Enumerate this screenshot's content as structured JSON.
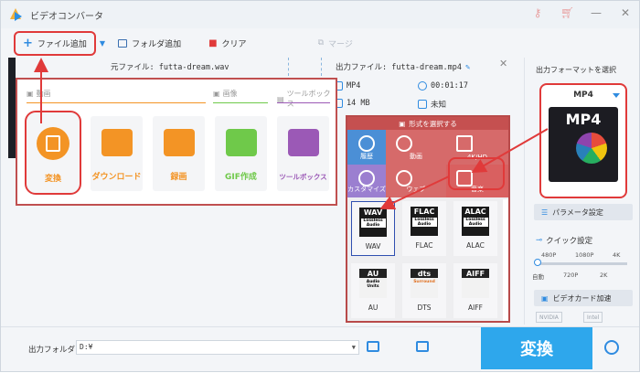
{
  "app": {
    "title": "ビデオコンバータ"
  },
  "toolbar": {
    "add_file": "ファイル追加",
    "add_folder": "フォルダ追加",
    "clear": "クリア",
    "merge": "マージ"
  },
  "file": {
    "source_label": "元ファイル: futta-dream.wav",
    "output_label": "出力ファイル: futta-dream.mp4",
    "format": "MP4",
    "duration": "00:01:17",
    "size": "14 MB",
    "resolution": "未知"
  },
  "function_menu": {
    "sections": [
      {
        "label": "動画"
      },
      {
        "label": "画像"
      },
      {
        "label": "ツールボックス"
      }
    ],
    "tiles": [
      {
        "label": "変換",
        "color": "#f39425"
      },
      {
        "label": "ダウンロード",
        "color": "#f39425"
      },
      {
        "label": "録画",
        "color": "#f39425"
      },
      {
        "label": "GIF作成",
        "color": "#6fc94a"
      },
      {
        "label": "ツールボックス",
        "color": "#9b59b6"
      }
    ]
  },
  "format_panel": {
    "header": "形式を選択する",
    "categories": [
      {
        "label": "履歴"
      },
      {
        "label": "動画"
      },
      {
        "label": "4K/HD"
      },
      {
        "label": "カスタマイズ"
      },
      {
        "label": "ウェブ"
      },
      {
        "label": "音楽"
      }
    ],
    "formats": [
      {
        "tag": "WAV",
        "sub": "Lossless Audio",
        "name": "WAV"
      },
      {
        "tag": "FLAC",
        "sub": "Lossless Audio",
        "name": "FLAC"
      },
      {
        "tag": "ALAC",
        "sub": "Lossless Audio",
        "name": "ALAC"
      },
      {
        "tag": "AU",
        "sub": "Audio Units",
        "name": "AU"
      },
      {
        "tag": "dts",
        "sub": "Surround",
        "name": "DTS"
      },
      {
        "tag": "AIFF",
        "sub": "",
        "name": "AIFF"
      }
    ]
  },
  "right_panel": {
    "title": "出力フォーマットを選択",
    "selected_format": "MP4",
    "preview_label": "MP4",
    "param_button": "パラメータ設定",
    "quick_label": "クイック設定",
    "slider_top": [
      "480P",
      "1080P",
      "4K"
    ],
    "slider_bottom": [
      "自動",
      "720P",
      "2K"
    ],
    "gpu_button": "ビデオカード加速",
    "gpu_chips": [
      "NVIDIA",
      "Intel"
    ]
  },
  "bottom": {
    "output_folder_label": "出力フォルダ：",
    "output_path": "D:¥",
    "convert_label": "変換"
  },
  "colors": {
    "accent": "#2ea7ec",
    "highlight": "#e03a3a"
  }
}
